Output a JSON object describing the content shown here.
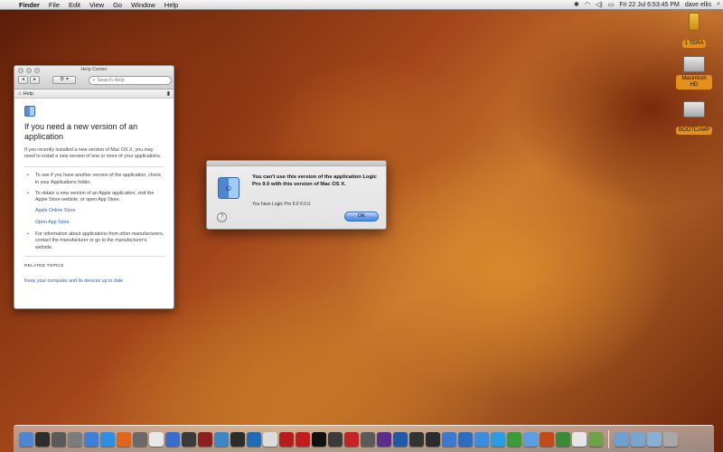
{
  "menubar": {
    "apple_glyph": "",
    "app_name": "Finder",
    "menus": [
      "File",
      "Edit",
      "View",
      "Go",
      "Window",
      "Help"
    ],
    "status": {
      "datetime": "Fri 22 Jul  6:53:45 PM",
      "user": "dave ellis"
    }
  },
  "desktop_icons": [
    {
      "label": "1 TERA",
      "kind": "usb-drive-icon"
    },
    {
      "label": "Macintosh HD",
      "kind": "hard-drive-icon"
    },
    {
      "label": "BOOTCAMP",
      "kind": "hard-drive-icon"
    }
  ],
  "help_window": {
    "title": "Help Center",
    "search_placeholder": "Search Help",
    "gear_glyph": "⚙ ▾",
    "crumb": "Help",
    "heading": "If you need a new version of an application",
    "intro": "If you recently installed a new version of Mac OS X, you may need to install a new version of one or more of your applications.",
    "bullets": [
      "To see if you have another version of the application, check in your Applications folder.",
      "To obtain a new version of an Apple application, visit the Apple Store website, or open App Store."
    ],
    "links": [
      "Apple Online Store",
      "Open App Store"
    ],
    "bullet3": "For information about applications from other manufacturers, contact the manufacturer or go to the manufacturer's website.",
    "related_label": "RELATED TOPICS",
    "related_link": "Keep your computer and its devices up to date"
  },
  "alert": {
    "message": "You can't use this version of the application Logic Pro 9.0 with this version of Mac OS X.",
    "info": "You have Logic Pro 9.0 9.0.0.",
    "help_glyph": "?",
    "ok_label": "OK"
  },
  "dock": {
    "apps": [
      {
        "name": "finder-icon",
        "color": "#4f86d2"
      },
      {
        "name": "dashboard-icon",
        "color": "#2d2d2d"
      },
      {
        "name": "mission-control-icon",
        "color": "#5a5a5a"
      },
      {
        "name": "system-prefs-icon",
        "color": "#7c7c7c"
      },
      {
        "name": "app-store-icon",
        "color": "#3f7fd8"
      },
      {
        "name": "safari-icon",
        "color": "#2e8fe0"
      },
      {
        "name": "firefox-icon",
        "color": "#e0661e"
      },
      {
        "name": "mail-icon",
        "color": "#6a6a6a"
      },
      {
        "name": "ical-icon",
        "color": "#e8e8e8"
      },
      {
        "name": "itunes-icon",
        "color": "#3c6cc9"
      },
      {
        "name": "time-machine-icon",
        "color": "#3a3a3a"
      },
      {
        "name": "photo-booth-icon",
        "color": "#8a2020"
      },
      {
        "name": "iphoto-icon",
        "color": "#3f86c5"
      },
      {
        "name": "aperture-icon",
        "color": "#2c2c2c"
      },
      {
        "name": "quicktime-icon",
        "color": "#1f6bb5"
      },
      {
        "name": "clock-icon",
        "color": "#dcdcdc"
      },
      {
        "name": "garageband-icon",
        "color": "#b51c1c"
      },
      {
        "name": "logic-icon",
        "color": "#c01e1e"
      },
      {
        "name": "mainstage-icon",
        "color": "#111111"
      },
      {
        "name": "compressor-icon",
        "color": "#3b3b3b"
      },
      {
        "name": "soundtrack-icon",
        "color": "#c42424"
      },
      {
        "name": "motion-icon",
        "color": "#5a5a5a"
      },
      {
        "name": "premiere-icon",
        "color": "#5a2d8c"
      },
      {
        "name": "photoshop-icon",
        "color": "#1e5aa6"
      },
      {
        "name": "cinema-icon",
        "color": "#333333"
      },
      {
        "name": "dvd-player-icon",
        "color": "#2c2c2c"
      },
      {
        "name": "xcode-icon",
        "color": "#3b7ad0"
      },
      {
        "name": "network-icon",
        "color": "#2d6cc0"
      },
      {
        "name": "preview-icon",
        "color": "#3b8de0"
      },
      {
        "name": "skype-icon",
        "color": "#2a9ce0"
      },
      {
        "name": "adium-icon",
        "color": "#3b9b3b"
      },
      {
        "name": "chat-icon",
        "color": "#5aa0e0"
      },
      {
        "name": "handbrake-icon",
        "color": "#c04a1a"
      },
      {
        "name": "chrome-icon",
        "color": "#3a8a3a"
      },
      {
        "name": "textedit-icon",
        "color": "#e6e6e6"
      },
      {
        "name": "cube-icon",
        "color": "#6fa04a"
      }
    ],
    "trailing": [
      {
        "name": "applications-folder-icon",
        "color": "#6f9fd0"
      },
      {
        "name": "documents-folder-icon",
        "color": "#7aa5d0"
      },
      {
        "name": "downloads-folder-icon",
        "color": "#8ab0d8"
      },
      {
        "name": "trash-icon",
        "color": "#a8a8a8"
      }
    ]
  }
}
